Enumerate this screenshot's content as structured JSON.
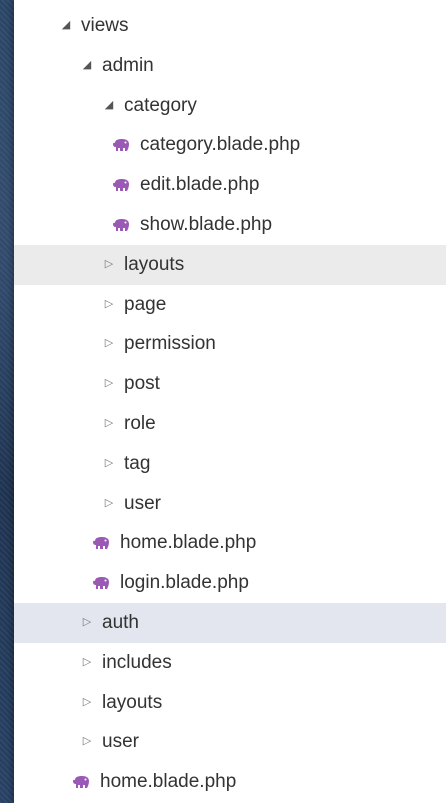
{
  "accent_colors": {
    "php_icon": "#9b59b6",
    "row_highlight": "#ebebeb",
    "row_selected": "#e3e6ef"
  },
  "tree": {
    "views": "views",
    "admin": "admin",
    "category": "category",
    "category_file_1": "category.blade.php",
    "category_file_2": "edit.blade.php",
    "category_file_3": "show.blade.php",
    "admin_layouts": "layouts",
    "admin_page": "page",
    "admin_permission": "permission",
    "admin_post": "post",
    "admin_role": "role",
    "admin_tag": "tag",
    "admin_user": "user",
    "admin_home": "home.blade.php",
    "admin_login": "login.blade.php",
    "auth": "auth",
    "includes": "includes",
    "layouts": "layouts",
    "user": "user",
    "home": "home.blade.php"
  },
  "icons": {
    "expanded": "expanded-triangle-icon",
    "collapsed": "collapsed-triangle-icon",
    "php_file": "php-elephant-icon"
  }
}
